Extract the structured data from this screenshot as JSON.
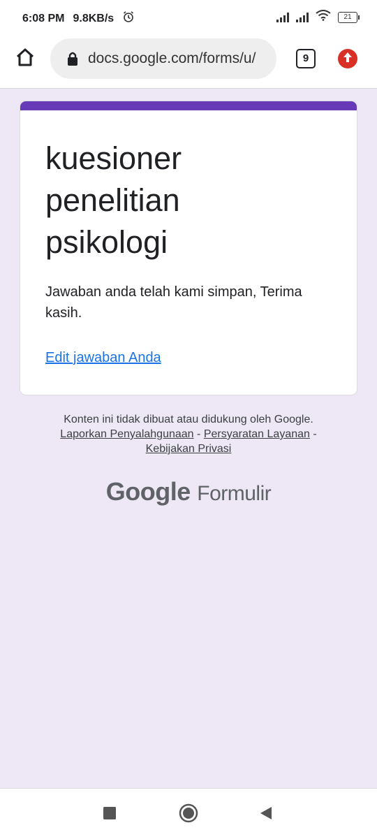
{
  "status_bar": {
    "time": "6:08 PM",
    "net_speed": "9.8KB/s",
    "battery": "21"
  },
  "browser": {
    "url": "docs.google.com/forms/u/",
    "tab_count": "9"
  },
  "form": {
    "title": "kuesioner penelitian psikologi",
    "confirmation": "Jawaban anda telah kami simpan, Terima kasih.",
    "edit_link": "Edit jawaban Anda",
    "accent_color": "#673ab7"
  },
  "footer": {
    "disclaimer": "Konten ini tidak dibuat atau didukung oleh Google.",
    "report_abuse": "Laporkan Penyalahgunaan",
    "terms": "Persyaratan Layanan",
    "privacy": "Kebijakan Privasi",
    "sep": "-",
    "brand_google": "Google",
    "brand_product": "Formulir"
  },
  "icons": {
    "home": "home-icon",
    "lock": "lock-icon",
    "tabs": "tabs-icon",
    "update": "update-icon",
    "nav_recents": "square-icon",
    "nav_home": "circle-icon",
    "nav_back": "back-triangle-icon"
  }
}
